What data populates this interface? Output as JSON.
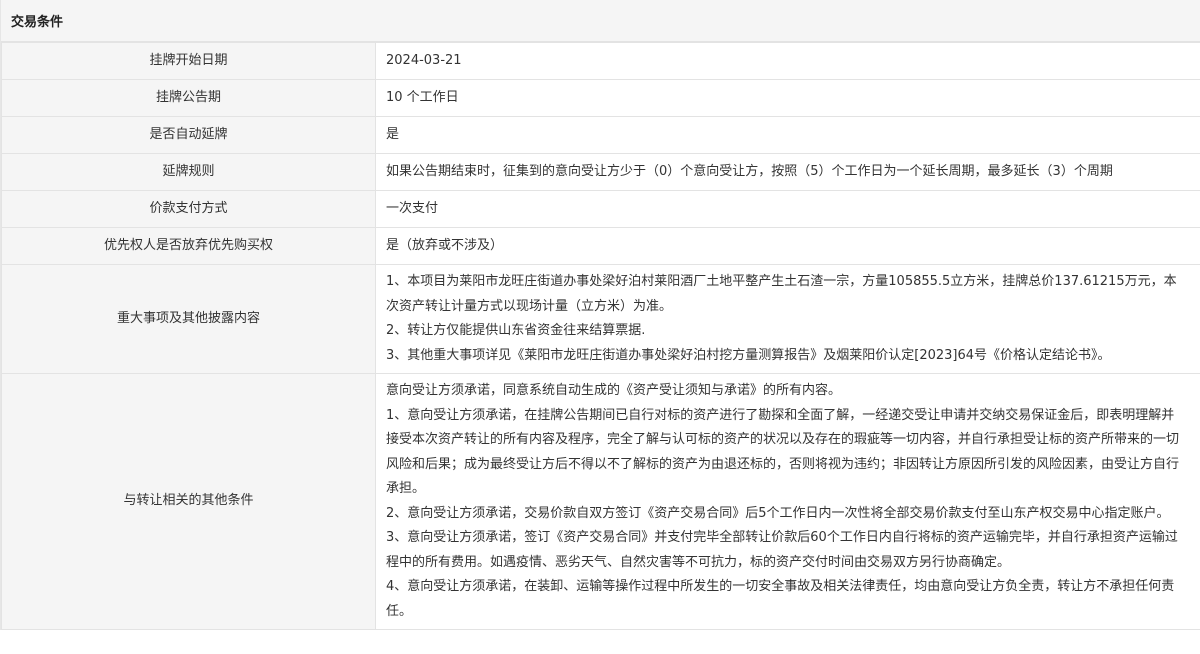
{
  "section_title": "交易条件",
  "rows": [
    {
      "label": "挂牌开始日期",
      "value": "2024-03-21"
    },
    {
      "label": "挂牌公告期",
      "value": "10 个工作日"
    },
    {
      "label": "是否自动延牌",
      "value": "是"
    },
    {
      "label": "延牌规则",
      "value": "如果公告期结束时，征集到的意向受让方少于（0）个意向受让方，按照（5）个工作日为一个延长周期，最多延长（3）个周期"
    },
    {
      "label": "价款支付方式",
      "value": "一次支付"
    },
    {
      "label": "优先权人是否放弃优先购买权",
      "value": "是（放弃或不涉及）"
    }
  ],
  "major_matters": {
    "label": "重大事项及其他披露内容",
    "paragraphs": [
      "1、本项目为莱阳市龙旺庄街道办事处梁好泊村莱阳酒厂土地平整产生土石渣一宗，方量105855.5立方米，挂牌总价137.61215万元，本次资产转让计量方式以现场计量（立方米）为准。",
      "2、转让方仅能提供山东省资金往来结算票据.",
      "3、其他重大事项详见《莱阳市龙旺庄街道办事处梁好泊村挖方量测算报告》及烟莱阳价认定[2023]64号《价格认定结论书》。"
    ]
  },
  "other_conditions": {
    "label": "与转让相关的其他条件",
    "paragraphs": [
      "意向受让方须承诺，同意系统自动生成的《资产受让须知与承诺》的所有内容。",
      "1、意向受让方须承诺，在挂牌公告期间已自行对标的资产进行了勘探和全面了解，一经递交受让申请并交纳交易保证金后，即表明理解并接受本次资产转让的所有内容及程序，完全了解与认可标的资产的状况以及存在的瑕疵等一切内容，并自行承担受让标的资产所带来的一切风险和后果；成为最终受让方后不得以不了解标的资产为由退还标的，否则将视为违约；非因转让方原因所引发的风险因素，由受让方自行承担。",
      "2、意向受让方须承诺，交易价款自双方签订《资产交易合同》后5个工作日内一次性将全部交易价款支付至山东产权交易中心指定账户。",
      "3、意向受让方须承诺，签订《资产交易合同》并支付完毕全部转让价款后60个工作日内自行将标的资产运输完毕，并自行承担资产运输过程中的所有费用。如遇疫情、恶劣天气、自然灾害等不可抗力，标的资产交付时间由交易双方另行协商确定。",
      "4、意向受让方须承诺，在装卸、运输等操作过程中所发生的一切安全事故及相关法律责任，均由意向受让方负全责，转让方不承担任何责任。"
    ]
  }
}
